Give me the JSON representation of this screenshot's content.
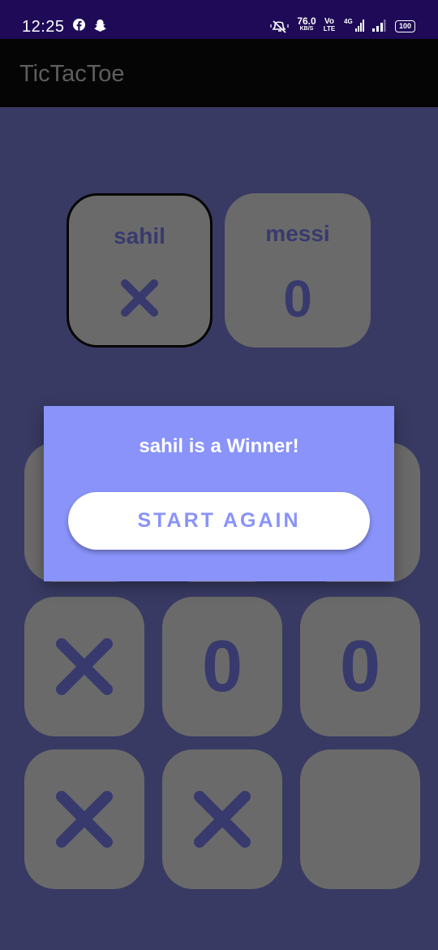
{
  "status_bar": {
    "time": "12:25",
    "net_speed": "76.0",
    "net_speed_unit": "KB/S",
    "volte_top": "Vo",
    "volte_bottom": "LTE",
    "net_type": "4G",
    "battery": "100",
    "icons": [
      "facebook-icon",
      "snapchat-icon",
      "mute-icon",
      "signal-icon",
      "battery-icon"
    ]
  },
  "app_bar": {
    "title": "TicTacToe"
  },
  "players": [
    {
      "name": "sahil",
      "symbol": "X",
      "active": true
    },
    {
      "name": "messi",
      "symbol": "0",
      "active": false
    }
  ],
  "board": {
    "cells": [
      "",
      "",
      "",
      "X",
      "0",
      "0",
      "X",
      "X",
      ""
    ]
  },
  "dialog": {
    "message": "sahil is a Winner!",
    "button_label": "START AGAIN"
  },
  "colors": {
    "background": "#383a63",
    "status_bar": "#1e0a57",
    "app_bar": "#050505",
    "tile": "#6a6a6a",
    "mark": "#383a6e",
    "dialog": "#8993f9",
    "button": "#ffffff"
  }
}
